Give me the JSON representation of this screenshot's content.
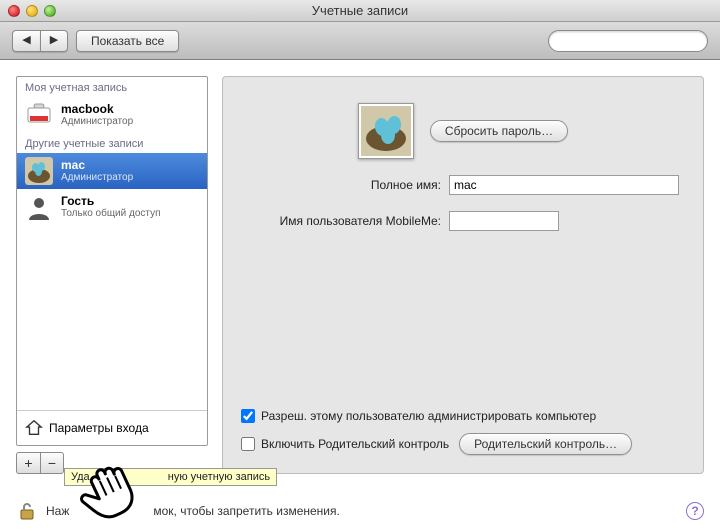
{
  "window": {
    "title": "Учетные записи"
  },
  "toolbar": {
    "show_all": "Показать все"
  },
  "sidebar": {
    "my_header": "Моя учетная запись",
    "other_header": "Другие учетные записи",
    "accounts": [
      {
        "name": "macbook",
        "role": "Администратор"
      },
      {
        "name": "mac",
        "role": "Администратор"
      },
      {
        "name": "Гость",
        "role": "Только общий доступ"
      }
    ],
    "login_options": "Параметры входа",
    "plus": "+",
    "minus": "−"
  },
  "detail": {
    "reset_password": "Сбросить пароль…",
    "fullname_label": "Полное имя:",
    "fullname_value": "mac",
    "mobileme_label": "Имя пользователя MobileMe:",
    "mobileme_value": "",
    "admin_checkbox": "Разреш. этому пользователю администрировать компьютер",
    "admin_checked": true,
    "parental_checkbox": "Включить Родительский контроль",
    "parental_checked": false,
    "parental_button": "Родительский контроль…"
  },
  "footer": {
    "lock_text_prefix": "Наж",
    "lock_text_suffix": "мок, чтобы запретить изменения."
  },
  "tooltip": {
    "prefix": "Уда",
    "suffix": "ную учетную запись"
  },
  "help_glyph": "?"
}
